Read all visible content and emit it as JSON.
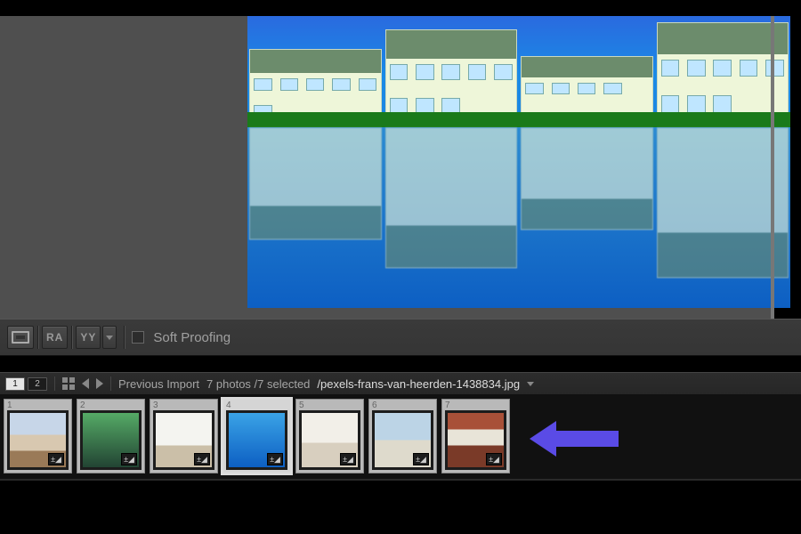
{
  "toolbar": {
    "view_loupe": "loupe",
    "view_compare": "RA",
    "view_survey": "YY",
    "soft_proofing_label": "Soft Proofing",
    "soft_proofing_checked": false
  },
  "filmstrip_header": {
    "monitor_primary": "1",
    "monitor_secondary": "2",
    "source_label": "Previous Import",
    "count_label": "7 photos /7 selected",
    "filename": "/pexels-frans-van-heerden-1438834.jpg"
  },
  "thumbnails": [
    {
      "index": "1",
      "selected": false,
      "has_develop_badge": true
    },
    {
      "index": "2",
      "selected": false,
      "has_develop_badge": true
    },
    {
      "index": "3",
      "selected": false,
      "has_develop_badge": true
    },
    {
      "index": "4",
      "selected": true,
      "has_develop_badge": true
    },
    {
      "index": "5",
      "selected": false,
      "has_develop_badge": true
    },
    {
      "index": "6",
      "selected": false,
      "has_develop_badge": true
    },
    {
      "index": "7",
      "selected": false,
      "has_develop_badge": true
    }
  ],
  "badge_glyph": "±◢",
  "annotation": {
    "type": "arrow",
    "direction": "left",
    "color": "#5a4be6"
  }
}
